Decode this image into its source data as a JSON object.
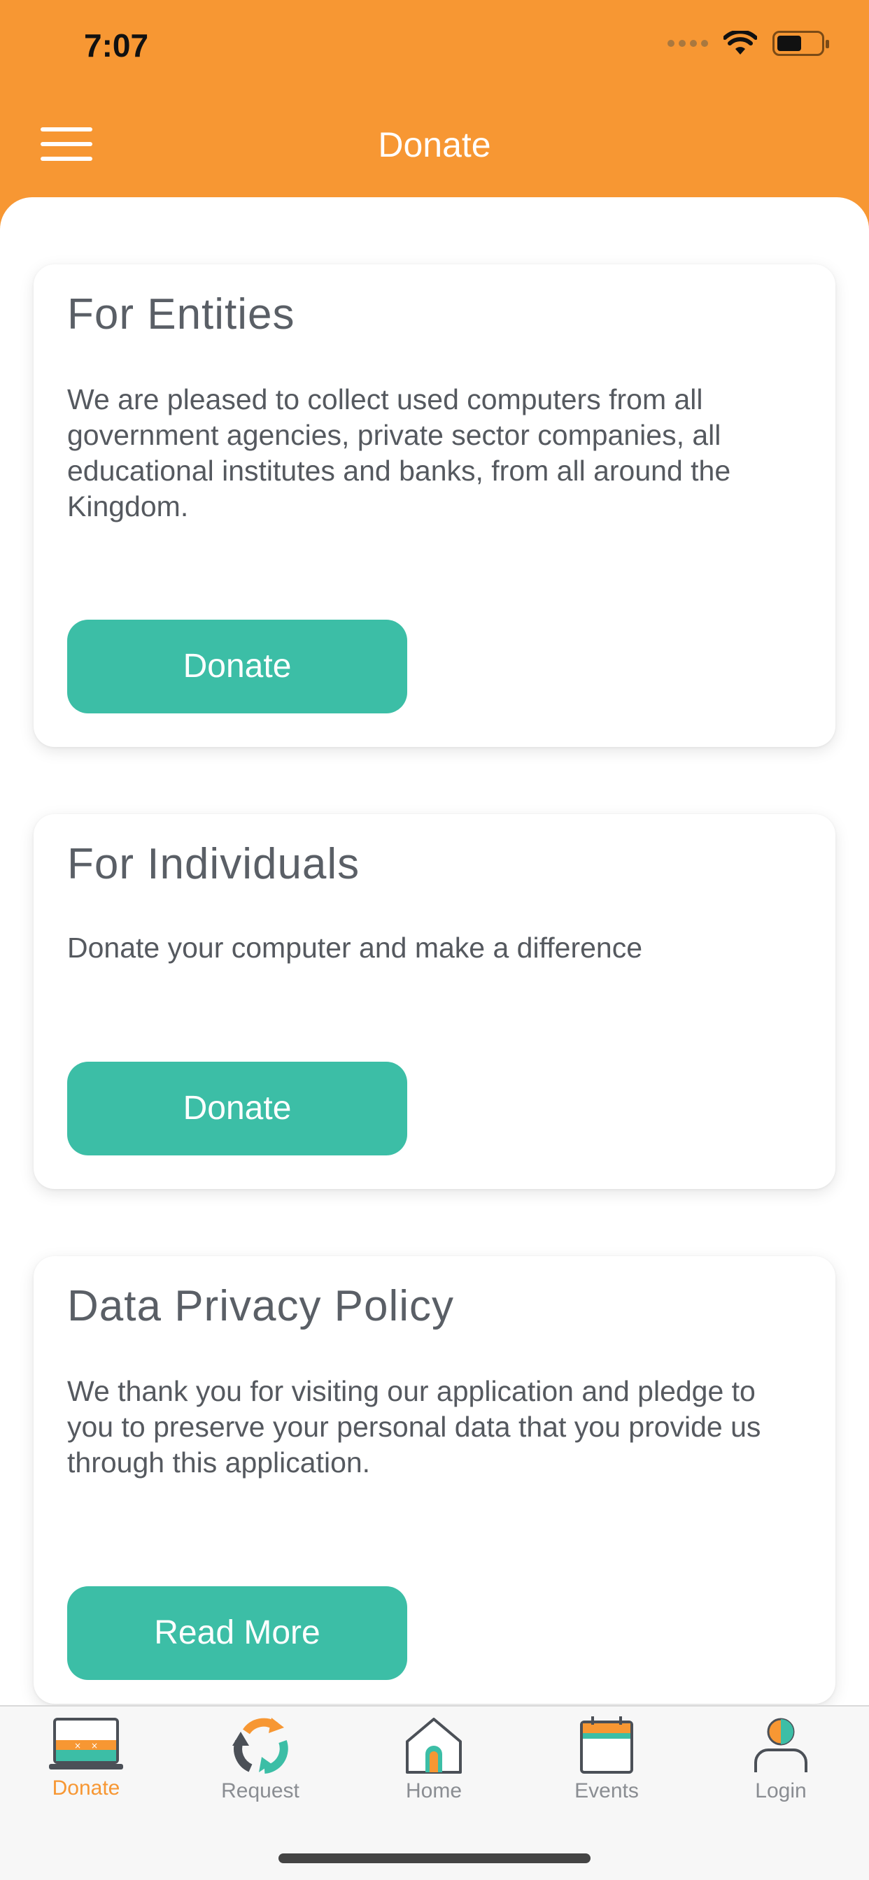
{
  "status_bar": {
    "time": "7:07"
  },
  "header": {
    "title": "Donate",
    "menu_icon": "hamburger-menu-icon"
  },
  "colors": {
    "brand_orange": "#f79733",
    "accent_teal": "#3cbea6",
    "text_gray": "#55595f"
  },
  "cards": [
    {
      "title": "For Entities",
      "text": "We are pleased to collect used computers from all government agencies, private sector companies, all educational institutes and banks, from all around the Kingdom.",
      "button": "Donate"
    },
    {
      "title": "For Individuals",
      "text": "Donate your computer and make a difference",
      "button": "Donate"
    },
    {
      "title": "Data Privacy Policy",
      "text": "We thank you for visiting our application and pledge to you to preserve your personal data that you provide us through this application.",
      "button": "Read More"
    }
  ],
  "tabbar": {
    "active": "Donate",
    "items": [
      {
        "label": "Donate",
        "icon": "laptop-icon"
      },
      {
        "label": "Request",
        "icon": "recycle-icon"
      },
      {
        "label": "Home",
        "icon": "home-icon"
      },
      {
        "label": "Events",
        "icon": "calendar-icon"
      },
      {
        "label": "Login",
        "icon": "user-icon"
      }
    ]
  }
}
